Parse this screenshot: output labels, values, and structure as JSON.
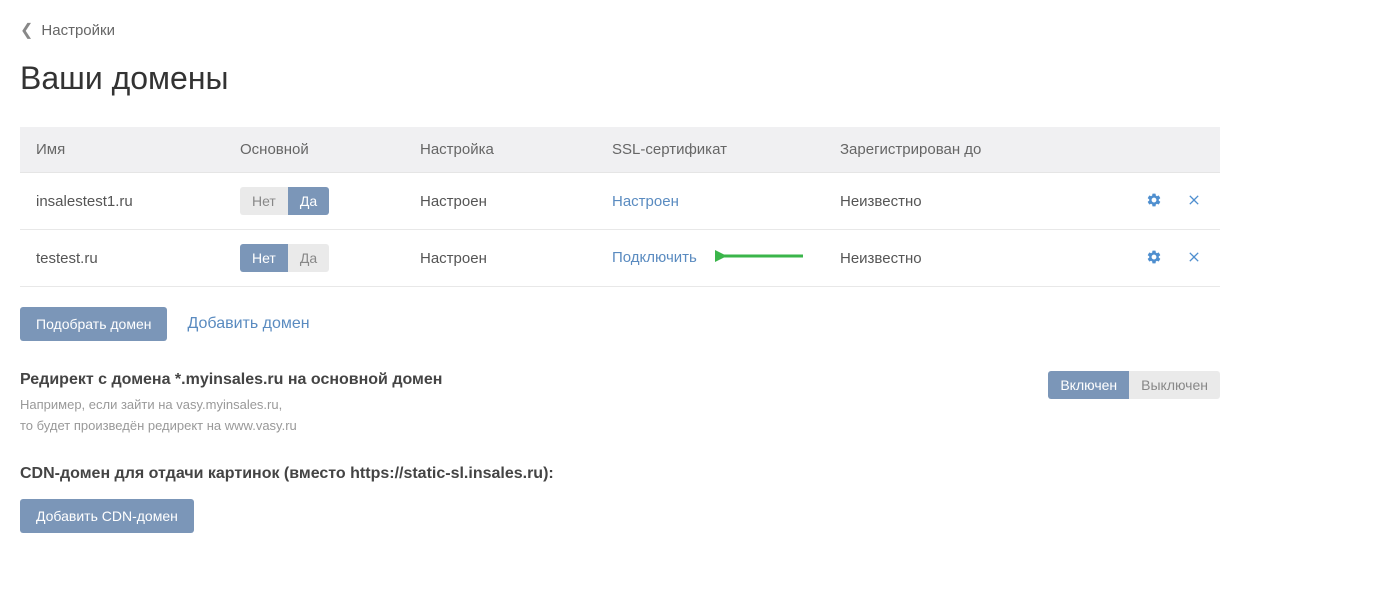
{
  "breadcrumb": {
    "back_label": "Настройки"
  },
  "page_title": "Ваши домены",
  "table": {
    "headers": {
      "name": "Имя",
      "main": "Основной",
      "setup": "Настройка",
      "ssl": "SSL-сертификат",
      "registered": "Зарегистрирован до"
    },
    "toggle_labels": {
      "no": "Нет",
      "yes": "Да"
    },
    "rows": [
      {
        "name": "insalestest1.ru",
        "main_active": "yes",
        "setup": "Настроен",
        "ssl_label": "Настроен",
        "registered": "Неизвестно"
      },
      {
        "name": "testest.ru",
        "main_active": "no",
        "setup": "Настроен",
        "ssl_label": "Подключить",
        "registered": "Неизвестно"
      }
    ]
  },
  "buttons": {
    "pick_domain": "Подобрать домен",
    "add_domain": "Добавить домен",
    "add_cdn": "Добавить CDN-домен"
  },
  "redirect_section": {
    "title": "Редирект с домена *.myinsales.ru на основной домен",
    "hint_line1": "Например, если зайти на vasy.myinsales.ru,",
    "hint_line2": "то будет произведён редирект на www.vasy.ru",
    "toggle": {
      "on": "Включен",
      "off": "Выключен"
    }
  },
  "cdn_section": {
    "title": "CDN-домен для отдачи картинок (вместо https://static-sl.insales.ru):"
  }
}
